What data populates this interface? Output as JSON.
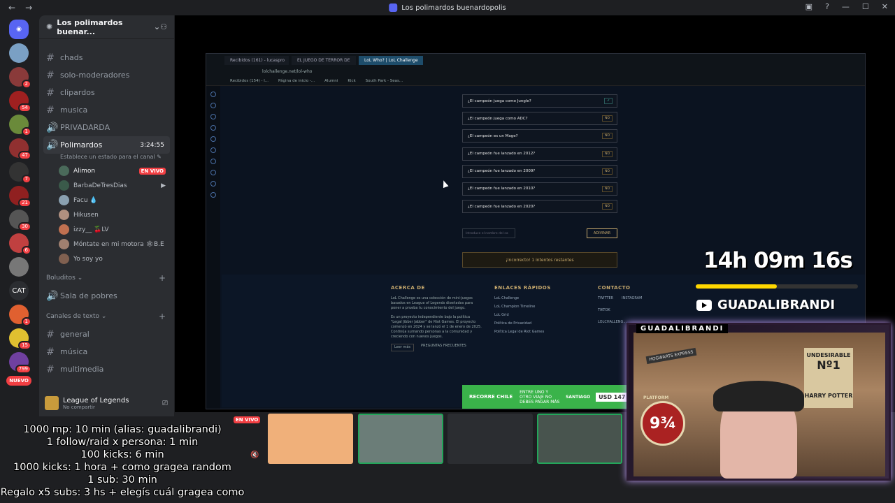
{
  "window": {
    "title": "Los polimardos buenardopolis"
  },
  "servers": [
    {
      "icon": "discord-home-icon",
      "badge": ""
    },
    {
      "icon": "server-avatar",
      "badge": ""
    },
    {
      "icon": "server-avatar",
      "badge": "2"
    },
    {
      "icon": "server-avatar",
      "badge": "54"
    },
    {
      "icon": "server-avatar",
      "badge": "1"
    },
    {
      "icon": "server-avatar",
      "badge": "47"
    },
    {
      "icon": "server-avatar",
      "badge": "7"
    },
    {
      "icon": "server-avatar",
      "badge": "21"
    },
    {
      "icon": "server-avatar",
      "badge": "30"
    },
    {
      "icon": "server-avatar",
      "badge": "6"
    },
    {
      "icon": "server-avatar",
      "badge": ""
    },
    {
      "icon": "server-text",
      "label": "CAT",
      "badge": ""
    },
    {
      "icon": "server-avatar",
      "badge": "1"
    },
    {
      "icon": "server-avatar",
      "badge": "15"
    },
    {
      "icon": "server-avatar",
      "badge": "799"
    },
    {
      "icon": "server-new",
      "label": "NUEVO",
      "badge": ""
    }
  ],
  "server_header": {
    "name": "Los polimardos buenar..."
  },
  "channels": [
    {
      "type": "text",
      "name": "chads"
    },
    {
      "type": "text",
      "name": "solo-moderadores"
    },
    {
      "type": "text",
      "name": "clipardos"
    },
    {
      "type": "text",
      "name": "musica"
    },
    {
      "type": "voice",
      "name": "PRIVADARDA"
    }
  ],
  "active_voice": {
    "name": "Polimardos",
    "time": "3:24:55",
    "status": "Establece un estado para el canal",
    "users": [
      {
        "name": "Alimon",
        "live": "EN VIVO"
      },
      {
        "name": "BarbaDeTresDias",
        "live": ""
      },
      {
        "name": "Facu 💧",
        "live": ""
      },
      {
        "name": "Hikusen",
        "live": ""
      },
      {
        "name": "izzy__ 🍒LV",
        "live": ""
      },
      {
        "name": "Móntate en mi motora 🕸B.E",
        "live": ""
      },
      {
        "name": "Yo soy yo",
        "live": ""
      }
    ]
  },
  "categories": {
    "boludites": {
      "label": "Boluditos",
      "channels": [
        {
          "type": "voice",
          "name": "Sala de pobres"
        }
      ]
    },
    "texto": {
      "label": "Canales de texto",
      "channels": [
        {
          "type": "text",
          "name": "general"
        },
        {
          "type": "text",
          "name": "música"
        },
        {
          "type": "text",
          "name": "multimedia"
        }
      ]
    }
  },
  "activity": {
    "game": "League of Legends",
    "sub": "No compartir"
  },
  "browser": {
    "tabs": [
      "Recibidos (161) - lucaspro",
      "EL JUEGO DE TERROR DE",
      "LoL Who? | LoL Challenge"
    ],
    "url": "lolchallenge.net/lol-who",
    "bookmarks": [
      "Recibidos (154) - l...",
      "Página de inicio -...",
      "Alumni",
      "Kick",
      "South Park - Seas..."
    ]
  },
  "questions": [
    {
      "text": "¿El campeón juega como Jungle?",
      "answer": "✓"
    },
    {
      "text": "¿El campeón juega como ADC?",
      "answer": "NO"
    },
    {
      "text": "¿El campeón es un Mage?",
      "answer": "NO"
    },
    {
      "text": "¿El campeón fue lanzado en 2012?",
      "answer": "NO"
    },
    {
      "text": "¿El campeón fue lanzado en 2009?",
      "answer": "NO"
    },
    {
      "text": "¿El campeón fue lanzado en 2010?",
      "answer": "NO"
    },
    {
      "text": "¿El campeón fue lanzado en 2020?",
      "answer": "NO"
    }
  ],
  "guess": {
    "placeholder": "Introduce el nombre del ca",
    "button": "ADIVINAR"
  },
  "result": "¡Incorrecto! 1 intentos restantes",
  "footer": {
    "about_title": "ACERCA DE",
    "about_text": "LoL Challenge es una colección de mini-juegos basados en League of Legends diseñados para poner a prueba tu conocimiento del juego.",
    "about_text2": "Es un proyecto independiente bajo la política \"Legal Jibber Jabber\" de Riot Games. El proyecto comenzó en 2024 y se lanzó el 1 de enero de 2025. Continúa sumando personas a la comunidad y creciendo con nuevos juegos.",
    "read_more": "Leer más",
    "faq": "PREGUNTAS FRECUENTES",
    "links_title": "ENLACES RÁPIDOS",
    "links": [
      "LoL Challenge",
      "LoL Champion Timeline",
      "LoL Grid",
      "Política de Privacidad",
      "Política Legal de Riot Games"
    ],
    "contact_title": "CONTACTO",
    "contact": [
      "TWITTER",
      "INSTAGRAM",
      "TIKTOK"
    ],
    "domain": "LOLCHALLENG..."
  },
  "ad": {
    "brand": "RECORRE CHILE",
    "text": "ENTRE UNO Y OTRO VIAJE NO DEBES PAGAR MÁS",
    "city": "SANTIAGO",
    "price": "USD 147"
  },
  "overlay": {
    "timer": "14h 09m 16s",
    "timer_progress_percent": 50,
    "channel": "GUADALIBRANDI",
    "cam_label": "GUADALIBRANDI",
    "poster_title": "UNDESIRABLE",
    "poster_num": "Nº1",
    "poster_name": "HARRY POTTER",
    "platform": "9¾",
    "platform_label": "PLATFORM",
    "hogwarts": "HOGWARTS EXPRESS"
  },
  "stream_bar": {
    "live": "EN VIVO"
  },
  "rules": [
    "1000 mp: 10 min (alias: guadalibrandi)",
    "1 follow/raid x persona: 1 min",
    "100 kicks: 6 min",
    "1000 kicks: 1 hora + como gragea random",
    "1 sub: 30 min",
    "Regalo x5 subs: 3 hs + elegís cuál gragea como"
  ]
}
